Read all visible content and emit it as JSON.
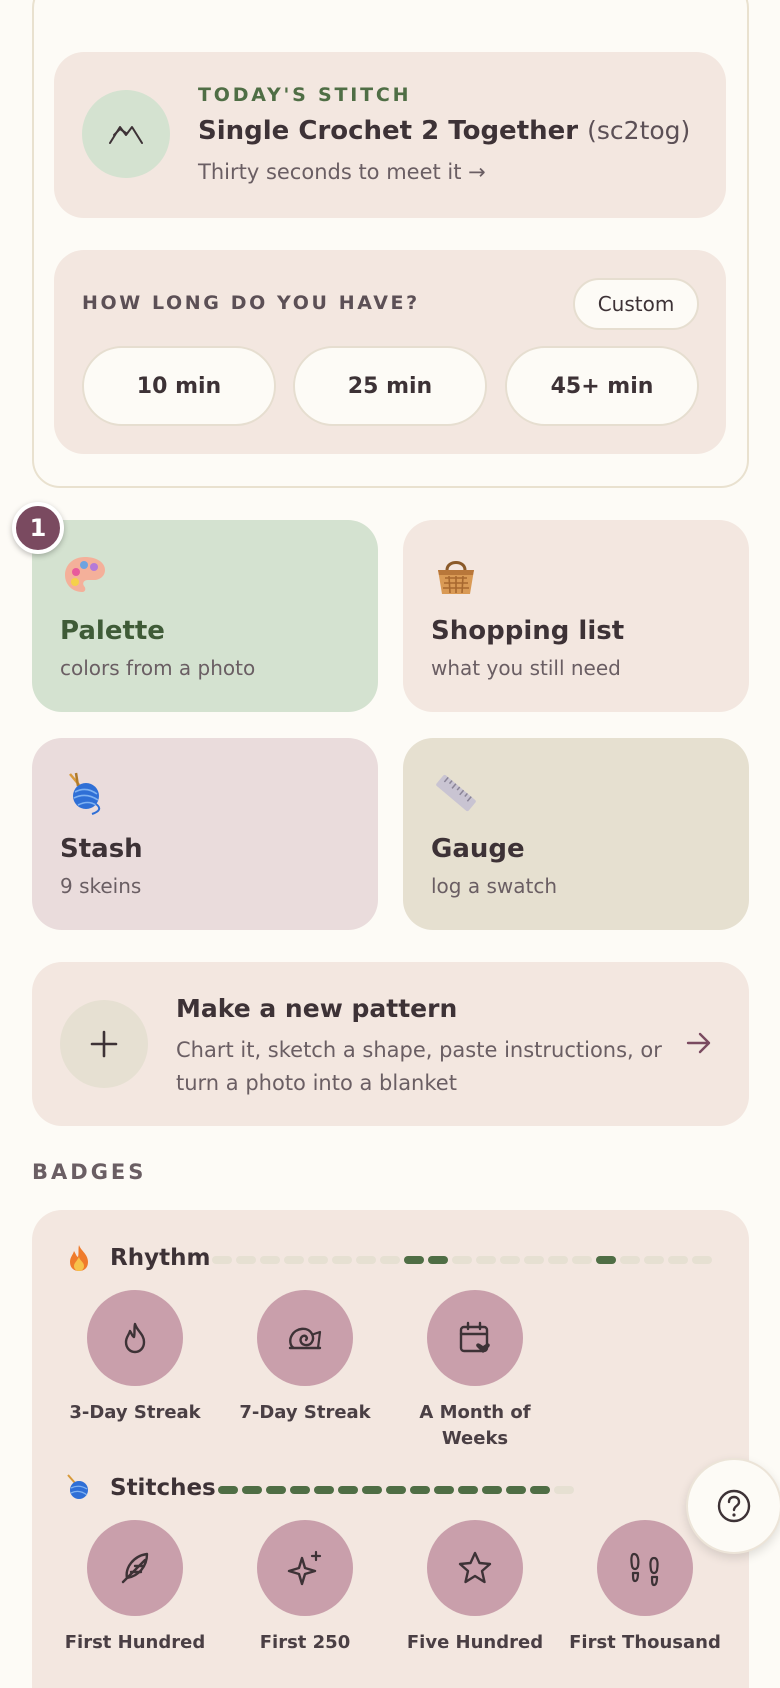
{
  "todays_stitch": {
    "kicker": "TODAY'S STITCH",
    "title": "Single Crochet 2 Together",
    "abbr": "(sc2tog)",
    "subtitle": "Thirty seconds to meet it →",
    "icon": "stitch-icon"
  },
  "time_picker": {
    "label": "HOW LONG DO YOU HAVE?",
    "custom_label": "Custom",
    "options": [
      "10 min",
      "25 min",
      "45+ min"
    ]
  },
  "tiles": [
    {
      "title": "Palette",
      "subtitle": "colors from a photo",
      "icon": "palette-icon",
      "bg": "#d4e2d0",
      "title_color": "#3f5b37"
    },
    {
      "title": "Shopping list",
      "subtitle": "what you still need",
      "icon": "basket-icon",
      "bg": "#f3e7e0",
      "title_color": "#3d3236"
    },
    {
      "title": "Stash",
      "subtitle": "9 skeins",
      "icon": "yarn-icon",
      "bg": "#eadcdc",
      "title_color": "#3d3236"
    },
    {
      "title": "Gauge",
      "subtitle": "log a swatch",
      "icon": "ruler-icon",
      "bg": "#e6e0d0",
      "title_color": "#3d3236"
    }
  ],
  "step_badge": "1",
  "new_pattern": {
    "title": "Make a new pattern",
    "description": "Chart it, sketch a shape, paste instructions, or turn a photo into a blanket"
  },
  "badges": {
    "heading": "BADGES",
    "rows": [
      {
        "name": "Rhythm",
        "icon": "fire-icon",
        "progress": [
          0,
          0,
          0,
          0,
          0,
          0,
          0,
          0,
          1,
          1,
          0,
          0,
          0,
          0,
          0,
          0,
          1,
          0,
          0,
          0,
          0
        ],
        "items": [
          {
            "label": "3-Day Streak",
            "icon": "flame-icon"
          },
          {
            "label": "7-Day Streak",
            "icon": "snail-icon"
          },
          {
            "label": "A Month of Weeks",
            "icon": "calendar-heart-icon"
          }
        ]
      },
      {
        "name": "Stitches",
        "icon": "yarn-ball-icon",
        "progress": [
          1,
          1,
          1,
          1,
          1,
          1,
          1,
          1,
          1,
          1,
          1,
          1,
          1,
          1,
          0
        ],
        "items": [
          {
            "label": "First Hundred",
            "icon": "feather-icon"
          },
          {
            "label": "First 250",
            "icon": "sparkle-icon"
          },
          {
            "label": "Five Hundred",
            "icon": "star-icon"
          },
          {
            "label": "First Thousand",
            "icon": "footprints-icon"
          }
        ]
      }
    ]
  },
  "help": {
    "icon": "help-icon"
  },
  "colors": {
    "accent": "#4f6e45",
    "badge": "#c99fab",
    "card": "#f3e7e0",
    "step": "#7a4a60"
  }
}
